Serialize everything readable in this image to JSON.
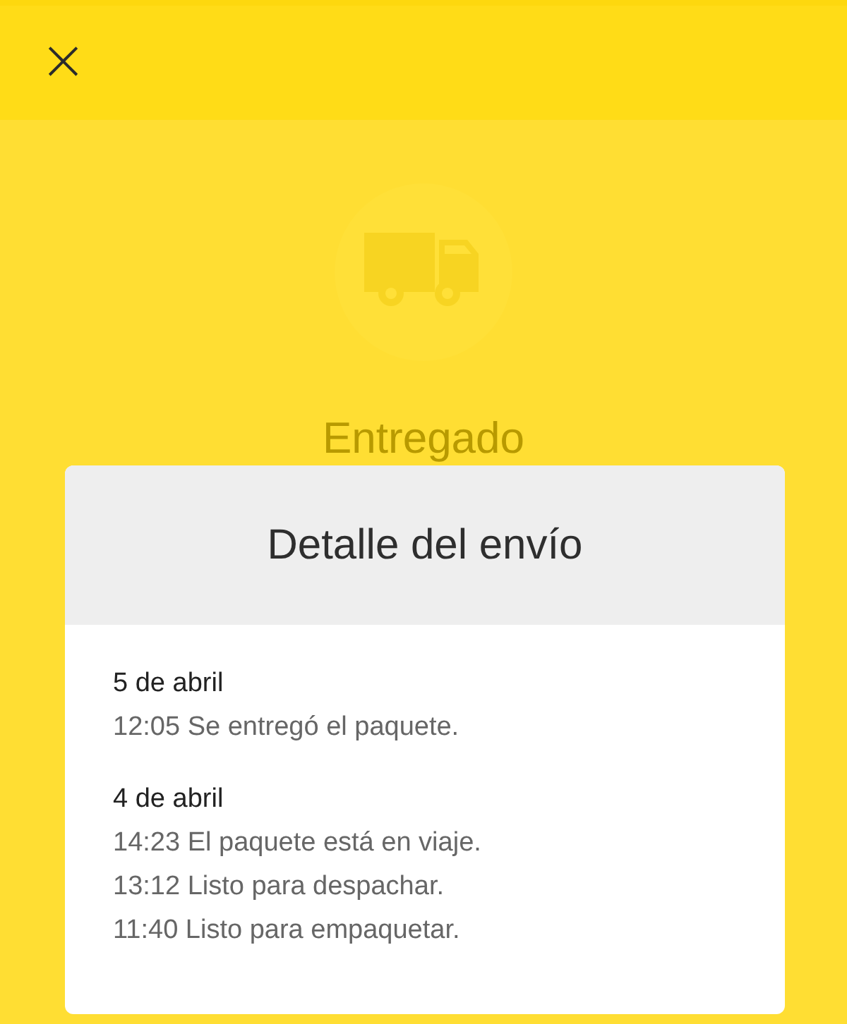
{
  "top_bar": {
    "close_icon": "×"
  },
  "status": {
    "label": "Entregado"
  },
  "dialog": {
    "title": "Detalle del envío",
    "days": [
      {
        "date": "5 de abril",
        "events": [
          "12:05 Se entregó el paquete."
        ]
      },
      {
        "date": "4 de abril",
        "events": [
          "14:23 El paquete está en viaje.",
          "13:12 Listo para despachar.",
          "11:40 Listo para empaquetar."
        ]
      }
    ]
  }
}
